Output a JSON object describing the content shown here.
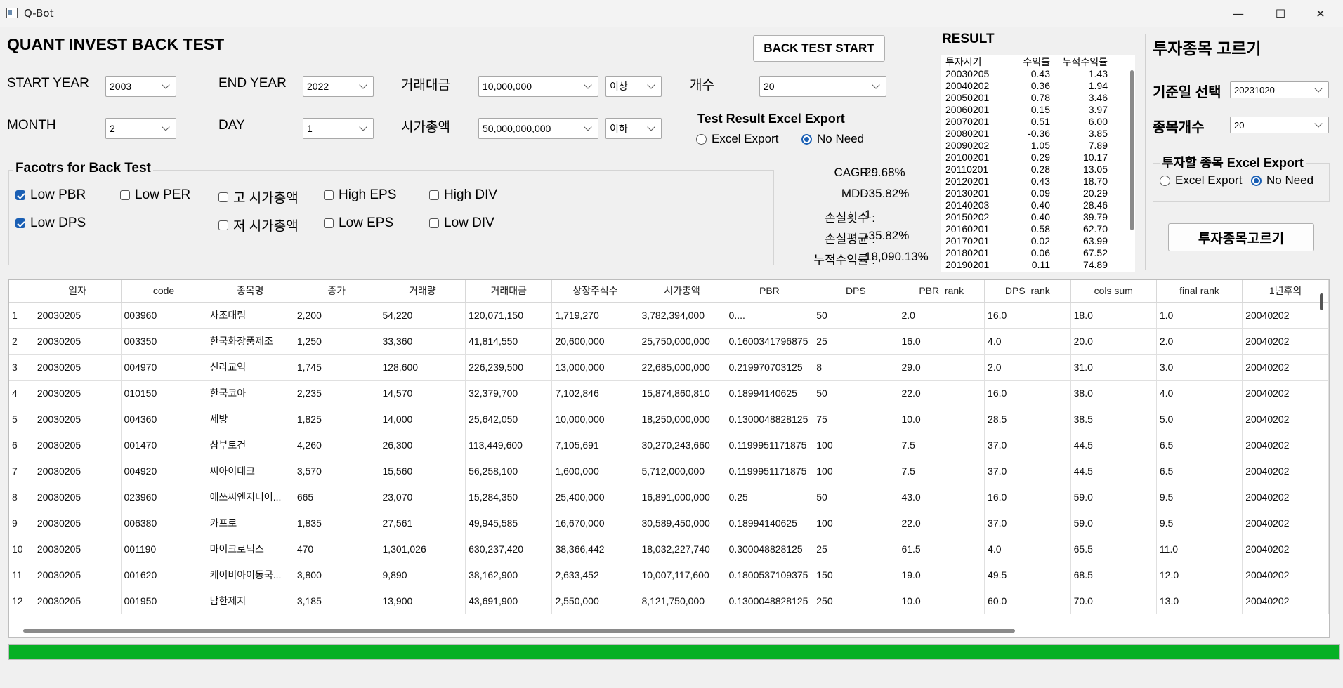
{
  "window": {
    "title": "Q-Bot",
    "minimize": "—",
    "maximize": "☐",
    "close": "✕"
  },
  "header": {
    "title": "QUANT INVEST BACK TEST",
    "start_button": "BACK TEST START"
  },
  "filters": {
    "start_year_label": "START YEAR",
    "start_year": "2003",
    "end_year_label": "END YEAR",
    "end_year": "2022",
    "volume_label": "거래대금",
    "volume": "10,000,000",
    "volume_cond": "이상",
    "count_label": "개수",
    "count": "20",
    "month_label": "MONTH",
    "month": "2",
    "day_label": "DAY",
    "day": "1",
    "mcap_label": "시가총액",
    "mcap": "50,000,000,000",
    "mcap_cond": "이하"
  },
  "export": {
    "title": "Test Result Excel Export",
    "opt1": "Excel Export",
    "opt2": "No Need",
    "selected": "No Need"
  },
  "factors": {
    "title": "Facotrs for Back Test",
    "items": [
      {
        "label": "Low PBR",
        "checked": true
      },
      {
        "label": "Low PER",
        "checked": false
      },
      {
        "label": "고 시가총액",
        "checked": false
      },
      {
        "label": "High EPS",
        "checked": false
      },
      {
        "label": "High DIV",
        "checked": false
      },
      {
        "label": "Low DPS",
        "checked": true
      },
      {
        "label": "저 시가총액",
        "checked": false
      },
      {
        "label": "Low EPS",
        "checked": false
      },
      {
        "label": "Low DIV",
        "checked": false
      }
    ]
  },
  "stats": {
    "cagr_label": "CAGR :",
    "cagr": "29.68%",
    "mdd_label": "MDD :",
    "mdd": "-35.82%",
    "loss_count_label": "손실횟수 :",
    "loss_count": "1",
    "loss_avg_label": "손실평균 :",
    "loss_avg": "-35.82%",
    "cum_label": "누적수익률 :",
    "cum": "18,090.13%"
  },
  "result": {
    "title": "RESULT",
    "headers": [
      "투자시기",
      "수익률",
      "누적수익률"
    ],
    "rows": [
      [
        "20030205",
        "0.43",
        "1.43"
      ],
      [
        "20040202",
        "0.36",
        "1.94"
      ],
      [
        "20050201",
        "0.78",
        "3.46"
      ],
      [
        "20060201",
        "0.15",
        "3.97"
      ],
      [
        "20070201",
        "0.51",
        "6.00"
      ],
      [
        "20080201",
        "-0.36",
        "3.85"
      ],
      [
        "20090202",
        "1.05",
        "7.89"
      ],
      [
        "20100201",
        "0.29",
        "10.17"
      ],
      [
        "20110201",
        "0.28",
        "13.05"
      ],
      [
        "20120201",
        "0.43",
        "18.70"
      ],
      [
        "20130201",
        "0.09",
        "20.29"
      ],
      [
        "20140203",
        "0.40",
        "28.46"
      ],
      [
        "20150202",
        "0.40",
        "39.79"
      ],
      [
        "20160201",
        "0.58",
        "62.70"
      ],
      [
        "20170201",
        "0.02",
        "63.99"
      ],
      [
        "20180201",
        "0.06",
        "67.52"
      ],
      [
        "20190201",
        "0.11",
        "74.89"
      ]
    ]
  },
  "picker": {
    "title": "투자종목 고르기",
    "date_label": "기준일 선택",
    "date": "20231020",
    "count_label": "종목개수",
    "count": "20",
    "export_title": "투자할 종목 Excel Export",
    "opt1": "Excel Export",
    "opt2": "No Need",
    "selected": "No Need",
    "button": "투자종목고르기"
  },
  "table": {
    "columns": [
      "일자",
      "code",
      "종목명",
      "종가",
      "거래량",
      "거래대금",
      "상장주식수",
      "시가총액",
      "PBR",
      "DPS",
      "PBR_rank",
      "DPS_rank",
      "cols sum",
      "final rank",
      "1년후의"
    ],
    "rows": [
      [
        "1",
        "20030205",
        "003960",
        "사조대림",
        "2,200",
        "54,220",
        "120,071,150",
        "1,719,270",
        "3,782,394,000",
        "0....",
        "50",
        "2.0",
        "16.0",
        "18.0",
        "1.0",
        "20040202"
      ],
      [
        "2",
        "20030205",
        "003350",
        "한국화장품제조",
        "1,250",
        "33,360",
        "41,814,550",
        "20,600,000",
        "25,750,000,000",
        "0.1600341796875",
        "25",
        "16.0",
        "4.0",
        "20.0",
        "2.0",
        "20040202"
      ],
      [
        "3",
        "20030205",
        "004970",
        "신라교역",
        "1,745",
        "128,600",
        "226,239,500",
        "13,000,000",
        "22,685,000,000",
        "0.219970703125",
        "8",
        "29.0",
        "2.0",
        "31.0",
        "3.0",
        "20040202"
      ],
      [
        "4",
        "20030205",
        "010150",
        "한국코아",
        "2,235",
        "14,570",
        "32,379,700",
        "7,102,846",
        "15,874,860,810",
        "0.18994140625",
        "50",
        "22.0",
        "16.0",
        "38.0",
        "4.0",
        "20040202"
      ],
      [
        "5",
        "20030205",
        "004360",
        "세방",
        "1,825",
        "14,000",
        "25,642,050",
        "10,000,000",
        "18,250,000,000",
        "0.1300048828125",
        "75",
        "10.0",
        "28.5",
        "38.5",
        "5.0",
        "20040202"
      ],
      [
        "6",
        "20030205",
        "001470",
        "삼부토건",
        "4,260",
        "26,300",
        "113,449,600",
        "7,105,691",
        "30,270,243,660",
        "0.1199951171875",
        "100",
        "7.5",
        "37.0",
        "44.5",
        "6.5",
        "20040202"
      ],
      [
        "7",
        "20030205",
        "004920",
        "씨아이테크",
        "3,570",
        "15,560",
        "56,258,100",
        "1,600,000",
        "5,712,000,000",
        "0.1199951171875",
        "100",
        "7.5",
        "37.0",
        "44.5",
        "6.5",
        "20040202"
      ],
      [
        "8",
        "20030205",
        "023960",
        "에쓰씨엔지니어...",
        "665",
        "23,070",
        "15,284,350",
        "25,400,000",
        "16,891,000,000",
        "0.25",
        "50",
        "43.0",
        "16.0",
        "59.0",
        "9.5",
        "20040202"
      ],
      [
        "9",
        "20030205",
        "006380",
        "카프로",
        "1,835",
        "27,561",
        "49,945,585",
        "16,670,000",
        "30,589,450,000",
        "0.18994140625",
        "100",
        "22.0",
        "37.0",
        "59.0",
        "9.5",
        "20040202"
      ],
      [
        "10",
        "20030205",
        "001190",
        "마이크로닉스",
        "470",
        "1,301,026",
        "630,237,420",
        "38,366,442",
        "18,032,227,740",
        "0.300048828125",
        "25",
        "61.5",
        "4.0",
        "65.5",
        "11.0",
        "20040202"
      ],
      [
        "11",
        "20030205",
        "001620",
        "케이비아이동국...",
        "3,800",
        "9,890",
        "38,162,900",
        "2,633,452",
        "10,007,117,600",
        "0.1800537109375",
        "150",
        "19.0",
        "49.5",
        "68.5",
        "12.0",
        "20040202"
      ],
      [
        "12",
        "20030205",
        "001950",
        "남한제지",
        "3,185",
        "13,900",
        "43,691,900",
        "2,550,000",
        "8,121,750,000",
        "0.1300048828125",
        "250",
        "10.0",
        "60.0",
        "70.0",
        "13.0",
        "20040202"
      ]
    ]
  },
  "progress": {
    "value": 1.0,
    "color": "#06b025"
  }
}
